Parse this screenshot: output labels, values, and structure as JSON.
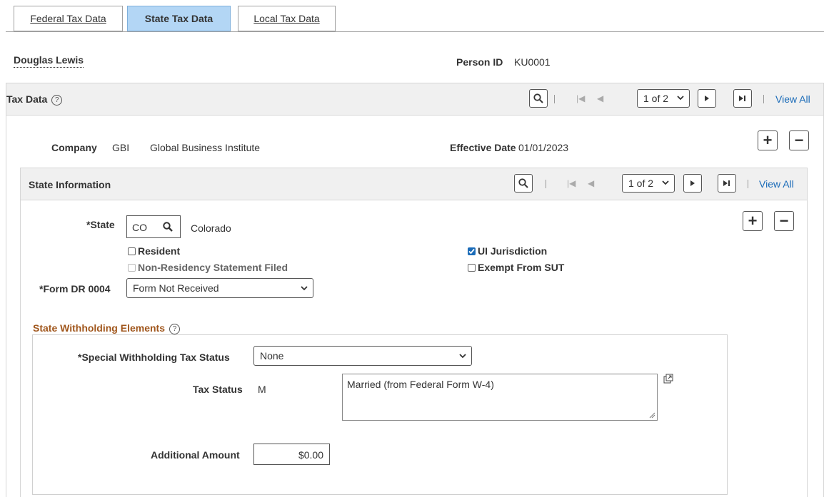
{
  "tabs": [
    {
      "label": "Federal Tax Data",
      "active": false
    },
    {
      "label": "State Tax Data",
      "active": true
    },
    {
      "label": "Local Tax Data",
      "active": false
    }
  ],
  "person": {
    "name": "Douglas Lewis",
    "id_label": "Person ID",
    "id_value": "KU0001"
  },
  "tax_data": {
    "title": "Tax Data",
    "pager": "1 of 2",
    "view_all": "View All",
    "company_label": "Company",
    "company_code": "GBI",
    "company_name": "Global Business Institute",
    "effective_date_label": "Effective Date",
    "effective_date": "01/01/2023"
  },
  "state_info": {
    "title": "State Information",
    "pager": "1 of 2",
    "view_all": "View All",
    "state_label": "*State",
    "state_code": "CO",
    "state_name": "Colorado",
    "resident_label": "Resident",
    "resident_checked": false,
    "non_residency_label": "Non-Residency Statement Filed",
    "ui_jurisdiction_label": "UI Jurisdiction",
    "ui_jurisdiction_checked": true,
    "exempt_sut_label": "Exempt From SUT",
    "exempt_sut_checked": false,
    "form_label": "*Form DR 0004",
    "form_value": "Form Not Received"
  },
  "withholding": {
    "title": "State Withholding Elements",
    "special_status_label": "*Special Withholding Tax Status",
    "special_status_value": "None",
    "tax_status_label": "Tax Status",
    "tax_status_code": "M",
    "tax_status_desc": "Married (from Federal Form W-4)",
    "additional_amount_label": "Additional Amount",
    "additional_amount_value": "$0.00"
  },
  "colors": {
    "accent": "#1a6bb8",
    "section_title": "#a0561c",
    "active_tab": "#b3d6f5"
  }
}
